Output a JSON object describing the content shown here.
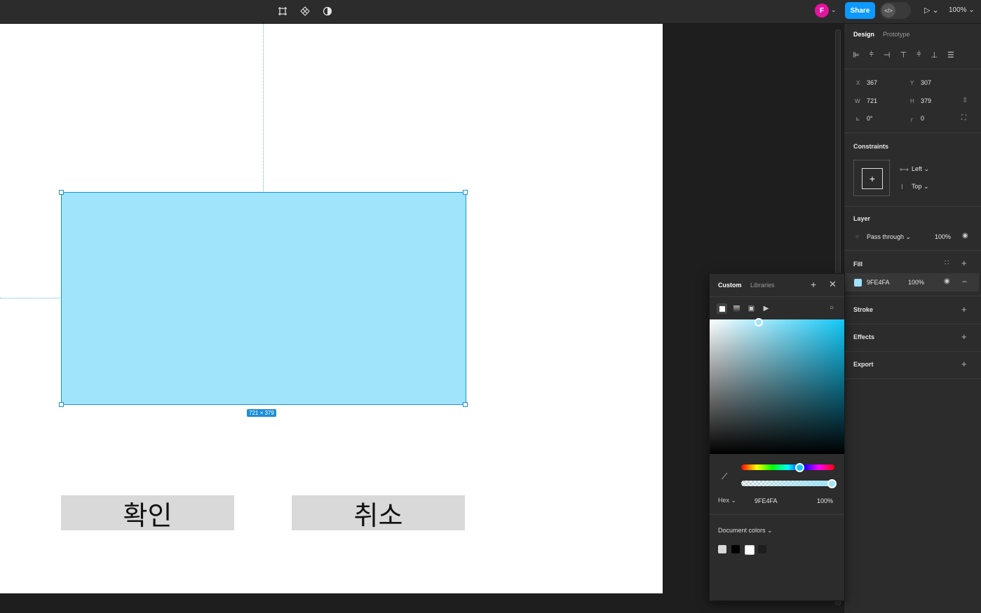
{
  "toolbar": {
    "avatar_initial": "F",
    "share_label": "Share",
    "devmode_glyph": "</>",
    "zoom": "100%"
  },
  "canvas": {
    "selection_size": "721 × 379",
    "confirm_label": "확인",
    "cancel_label": "취소",
    "fill_color": "#9FE4FA"
  },
  "panel": {
    "tabs": [
      "Design",
      "Prototype"
    ],
    "x_label": "X",
    "x": "367",
    "y_label": "Y",
    "y": "307",
    "w_label": "W",
    "w": "721",
    "h_label": "H",
    "h": "379",
    "rotation": "0°",
    "radius": "0",
    "constraints_title": "Constraints",
    "constraint_h": "Left",
    "constraint_v": "Top",
    "layer_title": "Layer",
    "blend_mode": "Pass through",
    "layer_opacity": "100%",
    "fill_title": "Fill",
    "fill_hex": "9FE4FA",
    "fill_opacity": "100%",
    "stroke_title": "Stroke",
    "effects_title": "Effects",
    "export_title": "Export"
  },
  "picker": {
    "tabs": [
      "Custom",
      "Libraries"
    ],
    "hue_level": 0.62,
    "alpha_level": 1.0,
    "format_label": "Hex",
    "hex": "9FE4FA",
    "opacity": "100%",
    "doc_colors_title": "Document colors",
    "doc_colors": [
      "#d9d9d9",
      "#000000",
      "#ffffff",
      "#1e1e1e"
    ]
  }
}
